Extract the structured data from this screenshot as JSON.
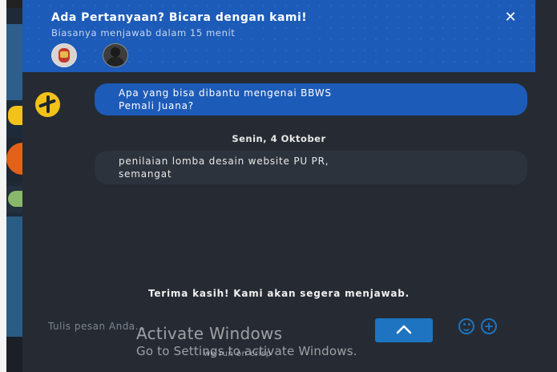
{
  "header": {
    "title": "Ada Pertanyaan? Bicara dengan kami!",
    "subtitle": "Biasanya menjawab dalam 15 menit",
    "close_symbol": "✕",
    "accent_color": "#1d5bb8"
  },
  "messages": {
    "agent_text": "Apa yang bisa dibantu mengenai BBWS\nPemali Juana?",
    "date": "Senin, 4 Oktober",
    "user_text": "penilaian lomba desain website PU PR,\nsemangat"
  },
  "status": {
    "thanks": "Terima kasih! Kami akan segera menjawab."
  },
  "composer": {
    "placeholder": "Tulis pesan Anda...",
    "icons": [
      "chevron-up-icon",
      "emoji-icon",
      "plus-icon"
    ]
  },
  "footer": {
    "brand": "we run on crisp"
  },
  "watermark": {
    "title": "Activate Windows",
    "subtitle": "Go to Settings to activate Windows."
  }
}
